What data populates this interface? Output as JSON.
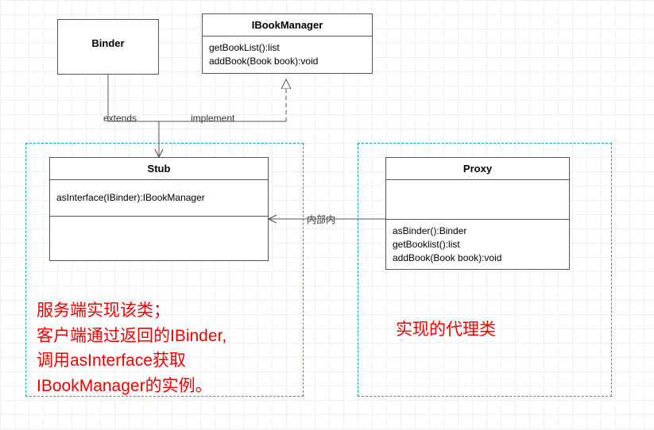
{
  "binder": {
    "title": "Binder"
  },
  "ibookmanager": {
    "title": "IBookManager",
    "methods": [
      "getBookList():list",
      "addBook(Book book):void"
    ]
  },
  "stub": {
    "title": "Stub",
    "methods": [
      "asInterface(IBinder):IBookManager"
    ]
  },
  "proxy": {
    "title": "Proxy",
    "methods": [
      "asBinder():Binder",
      "getBooklist():list",
      "addBook(Book book):void"
    ]
  },
  "edges": {
    "extends_label": "extends",
    "implement_label": "implement",
    "inner_label": "内部内"
  },
  "annotations": {
    "left_text": "服务端实现该类；\n客户端通过返回的IBinder,\n调用asInterface获取\nIBookManager的实例。",
    "right_text": "实现的代理类"
  }
}
